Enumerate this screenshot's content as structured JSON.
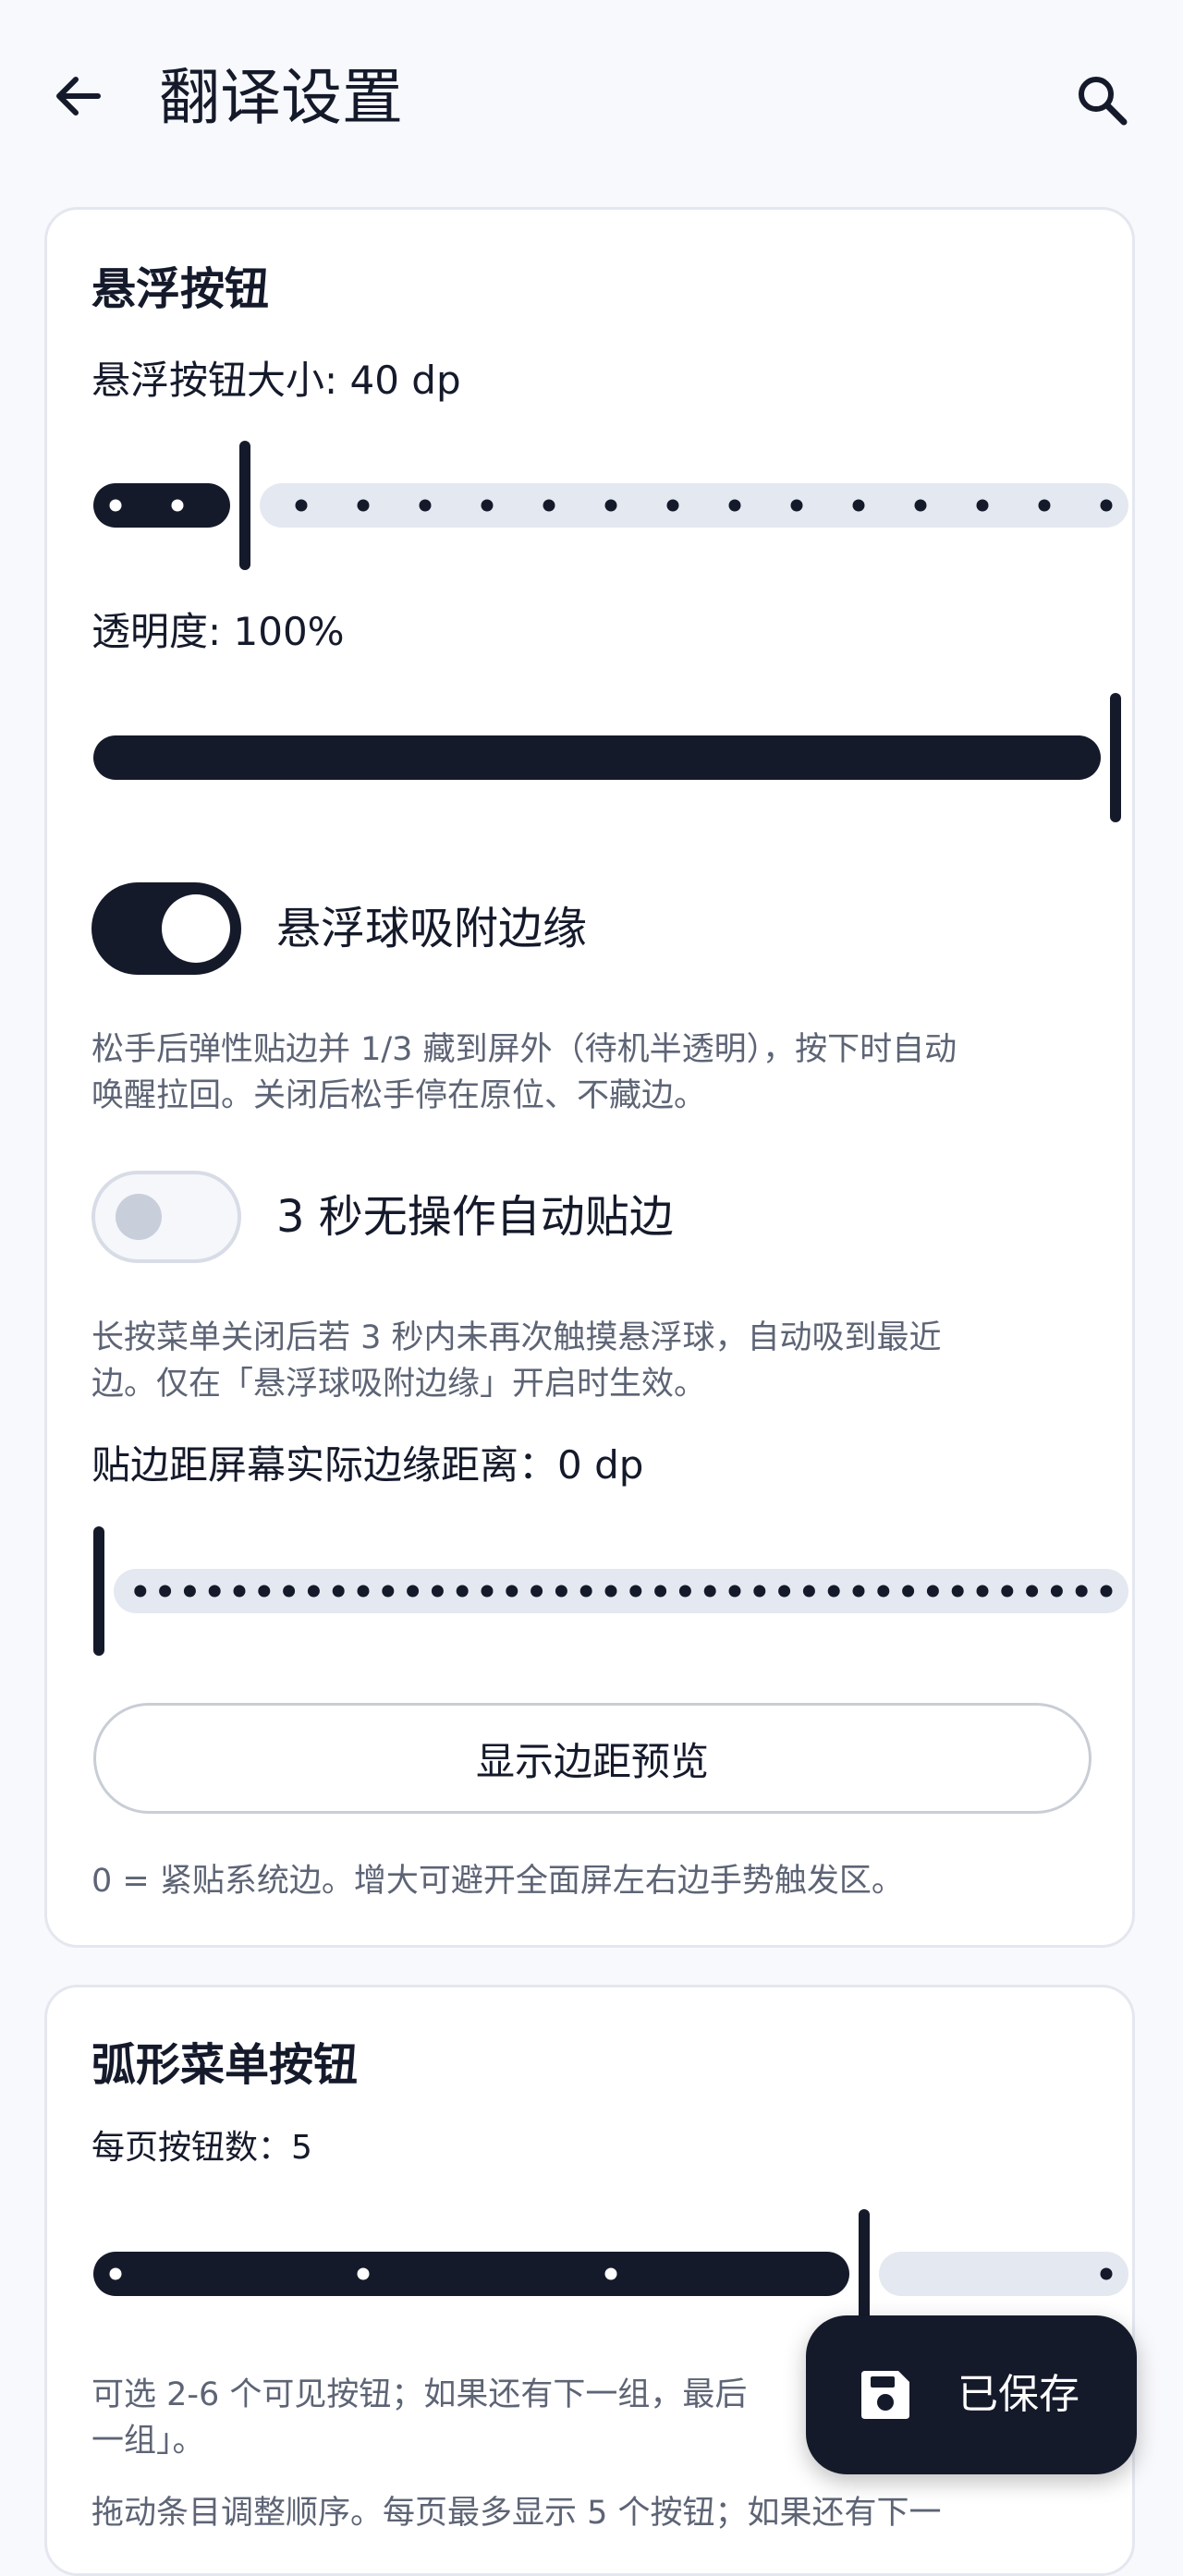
{
  "app_bar": {
    "title": "翻译设置",
    "back_icon": "arrow-left-icon",
    "search_icon": "search-icon"
  },
  "floating_button": {
    "section_title": "悬浮按钮",
    "size": {
      "label": "悬浮按钮大小: 40 dp",
      "min": 0,
      "max": 16,
      "value": 2
    },
    "opacity": {
      "label": "透明度: 100%",
      "value": 1.0
    },
    "snap_edge": {
      "label": "悬浮球吸附边缘",
      "enabled": true,
      "description_lines": [
        "松手后弹性贴边并 1/3 藏到屏外（待机半透明），按下时自动",
        "唤醒拉回。关闭后松手停在原位、不藏边。"
      ]
    },
    "auto_snap": {
      "label": "3 秒无操作自动贴边",
      "enabled": false,
      "description_lines": [
        "长按菜单关闭后若 3 秒内未再次触摸悬浮球，自动吸到最近",
        "边。仅在「悬浮球吸附边缘」开启时生效。"
      ]
    },
    "edge_distance": {
      "label": "贴边距屏幕实际边缘距离：0 dp",
      "min": 0,
      "max": 40,
      "value": 0
    },
    "preview_button": "显示边距预览",
    "edge_note": "0 = 紧贴系统边。增大可避开全面屏左右边手势触发区。"
  },
  "arc_menu": {
    "section_title": "弧形菜单按钮",
    "per_page": {
      "label": "每页按钮数：5",
      "min": 2,
      "max": 6,
      "value": 5
    },
    "description_lines": [
      "可选 2-6 个可见按钮；如果还有下一组，最后",
      "一组」。"
    ],
    "extra_line": "拖动条目调整顺序。每页最多显示 5 个按钮；如果还有下一"
  },
  "fab": {
    "label": "已保存",
    "icon": "save-icon"
  },
  "colors": {
    "accent": "#151A2B",
    "track_inactive": "#E4E8F0",
    "background": "#F8F9FC",
    "card": "#FFFFFF",
    "muted_text": "#5D6475"
  }
}
